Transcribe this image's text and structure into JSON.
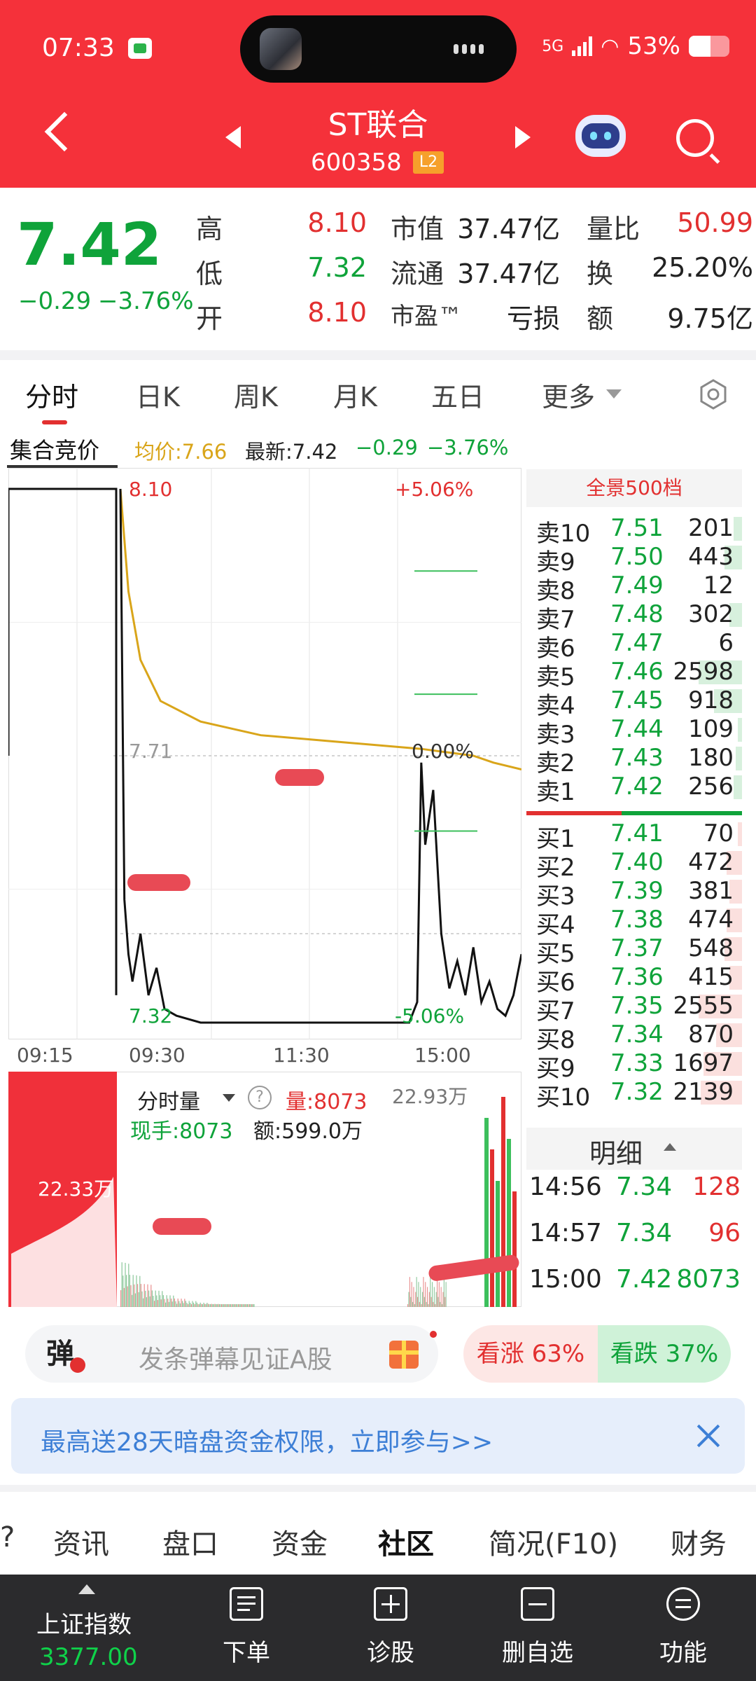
{
  "status": {
    "time": "07:33",
    "network": "5G",
    "battery": "53%"
  },
  "header": {
    "title": "ST联合",
    "code": "600358",
    "level": "L2"
  },
  "quote": {
    "price": "7.42",
    "change": "−0.29",
    "change_pct": "−3.76%",
    "high_label": "高",
    "high": "8.10",
    "low_label": "低",
    "low": "7.32",
    "open_label": "开",
    "open": "8.10",
    "mcap_label": "市值",
    "mcap": "37.47亿",
    "float_label": "流通",
    "float": "37.47亿",
    "pe_label": "市盈™",
    "pe": "亏损",
    "vr_label": "量比",
    "vr": "50.99",
    "turnover_label": "换",
    "turnover": "25.20%",
    "amount_label": "额",
    "amount": "9.75亿"
  },
  "tabs": [
    "分时",
    "日K",
    "周K",
    "月K",
    "五日",
    "更多"
  ],
  "info": {
    "auction": "集合竞价",
    "avg": "均价:7.66",
    "latest": "最新:7.42",
    "chg": "−0.29",
    "pct": "−3.76%"
  },
  "chart": {
    "high_label": "8.10",
    "high_pct": "+5.06%",
    "mid_label": "7.71",
    "mid_pct": "0.00%",
    "low_label": "7.32",
    "low_pct": "-5.06%",
    "times": [
      "09:15",
      "09:30",
      "11:30",
      "15:00"
    ]
  },
  "chart_data": {
    "type": "line",
    "x_labels": [
      "09:15",
      "09:30",
      "11:30",
      "15:00"
    ],
    "ylim": [
      7.32,
      8.1
    ],
    "reference": 7.71,
    "series": [
      {
        "name": "均价",
        "color": "#d9a51a",
        "points": [
          [
            0.0,
            8.1
          ],
          [
            0.02,
            7.95
          ],
          [
            0.05,
            7.85
          ],
          [
            0.1,
            7.79
          ],
          [
            0.2,
            7.76
          ],
          [
            0.35,
            7.74
          ],
          [
            0.55,
            7.73
          ],
          [
            0.75,
            7.72
          ],
          [
            0.88,
            7.71
          ],
          [
            0.93,
            7.7
          ],
          [
            1.0,
            7.69
          ]
        ]
      },
      {
        "name": "最新",
        "color": "#111111",
        "points": [
          [
            0.0,
            8.1
          ],
          [
            0.01,
            7.5
          ],
          [
            0.02,
            7.42
          ],
          [
            0.03,
            7.38
          ],
          [
            0.05,
            7.45
          ],
          [
            0.07,
            7.36
          ],
          [
            0.09,
            7.4
          ],
          [
            0.11,
            7.34
          ],
          [
            0.14,
            7.33
          ],
          [
            0.2,
            7.32
          ],
          [
            0.3,
            7.32
          ],
          [
            0.45,
            7.32
          ],
          [
            0.6,
            7.32
          ],
          [
            0.72,
            7.32
          ],
          [
            0.74,
            7.35
          ],
          [
            0.75,
            7.7
          ],
          [
            0.76,
            7.58
          ],
          [
            0.78,
            7.66
          ],
          [
            0.8,
            7.45
          ],
          [
            0.82,
            7.37
          ],
          [
            0.84,
            7.41
          ],
          [
            0.86,
            7.36
          ],
          [
            0.88,
            7.43
          ],
          [
            0.9,
            7.35
          ],
          [
            0.92,
            7.38
          ],
          [
            0.94,
            7.34
          ],
          [
            0.96,
            7.33
          ],
          [
            0.98,
            7.36
          ],
          [
            1.0,
            7.42
          ]
        ]
      }
    ],
    "pre_auction": {
      "open": 8.1,
      "low": 7.71
    }
  },
  "volume": {
    "title": "分时量",
    "vol": "量:8073",
    "hand": "现手:8073",
    "amount": "额:599.0万",
    "max": "22.93万",
    "auction_max": "22.33万"
  },
  "orderbook": {
    "title": "全景500档",
    "sells": [
      {
        "label": "卖10",
        "price": "7.51",
        "vol": "201",
        "bar": 0.04
      },
      {
        "label": "卖9",
        "price": "7.50",
        "vol": "443",
        "bar": 0.08
      },
      {
        "label": "卖8",
        "price": "7.49",
        "vol": "12",
        "bar": 0.0
      },
      {
        "label": "卖7",
        "price": "7.48",
        "vol": "302",
        "bar": 0.06
      },
      {
        "label": "卖6",
        "price": "7.47",
        "vol": "6",
        "bar": 0.0
      },
      {
        "label": "卖5",
        "price": "7.46",
        "vol": "2598",
        "bar": 0.2
      },
      {
        "label": "卖4",
        "price": "7.45",
        "vol": "918",
        "bar": 0.13
      },
      {
        "label": "卖3",
        "price": "7.44",
        "vol": "109",
        "bar": 0.02
      },
      {
        "label": "卖2",
        "price": "7.43",
        "vol": "180",
        "bar": 0.03
      },
      {
        "label": "卖1",
        "price": "7.42",
        "vol": "256",
        "bar": 0.04
      }
    ],
    "buys": [
      {
        "label": "买1",
        "price": "7.41",
        "vol": "70",
        "bar": 0.02
      },
      {
        "label": "买2",
        "price": "7.40",
        "vol": "472",
        "bar": 0.07
      },
      {
        "label": "买3",
        "price": "7.39",
        "vol": "381",
        "bar": 0.06
      },
      {
        "label": "买4",
        "price": "7.38",
        "vol": "474",
        "bar": 0.07
      },
      {
        "label": "买5",
        "price": "7.37",
        "vol": "548",
        "bar": 0.08
      },
      {
        "label": "买6",
        "price": "7.36",
        "vol": "415",
        "bar": 0.06
      },
      {
        "label": "买7",
        "price": "7.35",
        "vol": "2555",
        "bar": 0.2
      },
      {
        "label": "买8",
        "price": "7.34",
        "vol": "870",
        "bar": 0.12
      },
      {
        "label": "买9",
        "price": "7.33",
        "vol": "1697",
        "bar": 0.18
      },
      {
        "label": "买10",
        "price": "7.32",
        "vol": "2139",
        "bar": 0.19
      }
    ],
    "colors": {
      "sell": "#d7f0dd",
      "buy": "#fbe0de"
    }
  },
  "detail": {
    "title": "明细",
    "rows": [
      {
        "time": "14:56",
        "price": "7.34",
        "vol": "128",
        "vol_color": "#e23030"
      },
      {
        "time": "14:57",
        "price": "7.34",
        "vol": "96",
        "vol_color": "#e23030"
      },
      {
        "time": "15:00",
        "price": "7.42",
        "vol": "8073",
        "vol_color": "#0fa33a"
      }
    ]
  },
  "danmu": {
    "tag": "弹",
    "placeholder": "发条弹幕见证A股",
    "up": "看涨 63%",
    "down": "看跌 37%"
  },
  "banner": {
    "text": "最高送28天暗盘资金权限，立即参与>>"
  },
  "news_tabs": [
    "资讯",
    "盘口",
    "资金",
    "社区",
    "简况(F10)",
    "财务"
  ],
  "bottom": {
    "index_name": "上证指数",
    "index_value": "3377.00",
    "items": [
      "下单",
      "诊股",
      "删自选",
      "功能"
    ]
  }
}
